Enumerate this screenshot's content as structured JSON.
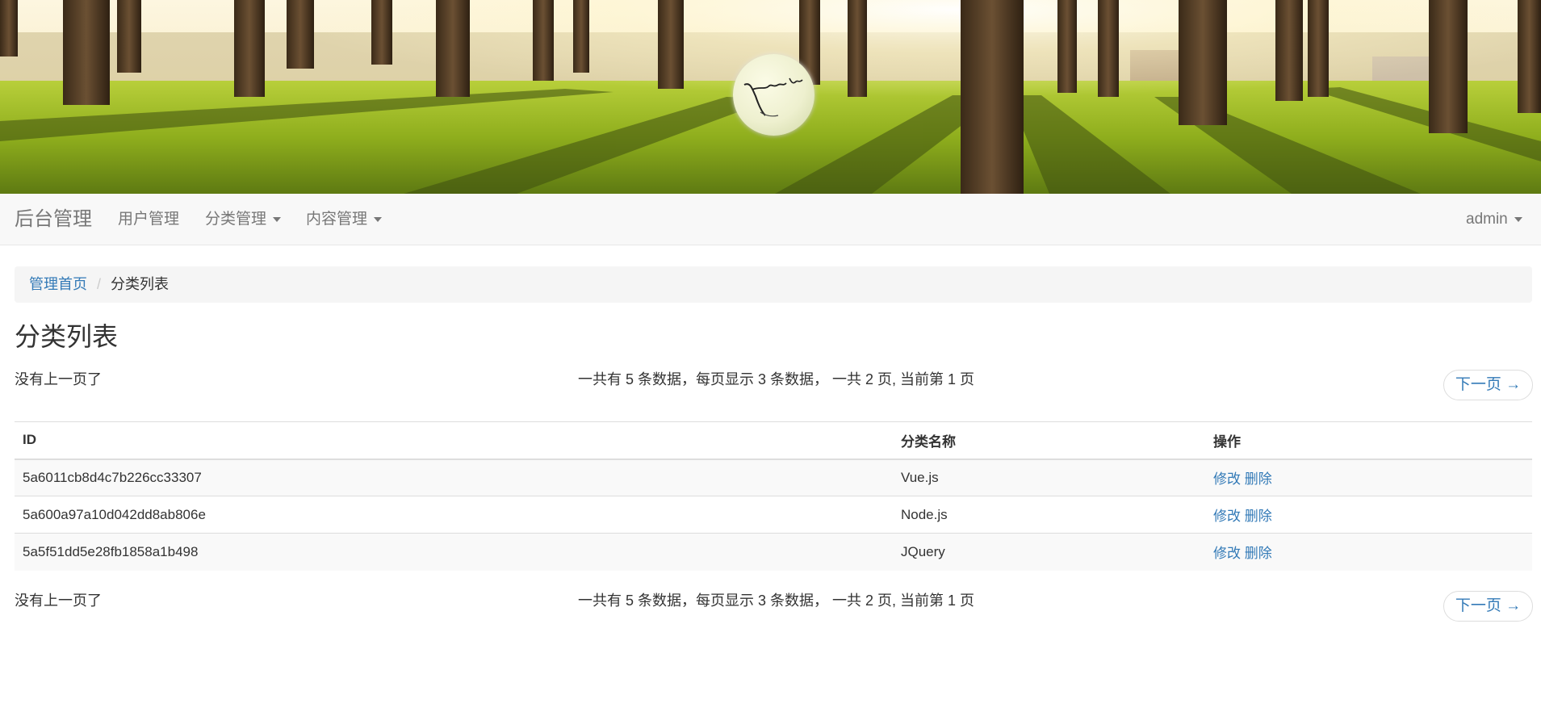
{
  "banner": {
    "logo_text": "Just do it!"
  },
  "navbar": {
    "brand": "后台管理",
    "items": [
      {
        "label": "用户管理"
      },
      {
        "label": "分类管理"
      },
      {
        "label": "内容管理"
      }
    ],
    "user": "admin"
  },
  "breadcrumb": {
    "home": "管理首页",
    "current": "分类列表"
  },
  "page_title": "分类列表",
  "pager": {
    "prev": "没有上一页了",
    "info": "一共有 5 条数据，每页显示 3 条数据， 一共 2 页, 当前第 1 页",
    "next": "下一页 →",
    "total_items": 5,
    "per_page": 3,
    "total_pages": 2,
    "current_page": 1
  },
  "table": {
    "headers": [
      "ID",
      "分类名称",
      "操作"
    ],
    "rows": [
      {
        "id": "5a6011cb8d4c7b226cc33307",
        "name": "Vue.js",
        "edit": "修改",
        "delete": "删除"
      },
      {
        "id": "5a600a97a10d042dd8ab806e",
        "name": "Node.js",
        "edit": "修改",
        "delete": "删除"
      },
      {
        "id": "5a5f51dd5e28fb1858a1b498",
        "name": "JQuery",
        "edit": "修改",
        "delete": "删除"
      }
    ]
  },
  "colors": {
    "link": "#337ab7",
    "navbar_bg": "#f8f8f8",
    "nav_text": "#777777",
    "breadcrumb_bg": "#f5f5f5"
  }
}
